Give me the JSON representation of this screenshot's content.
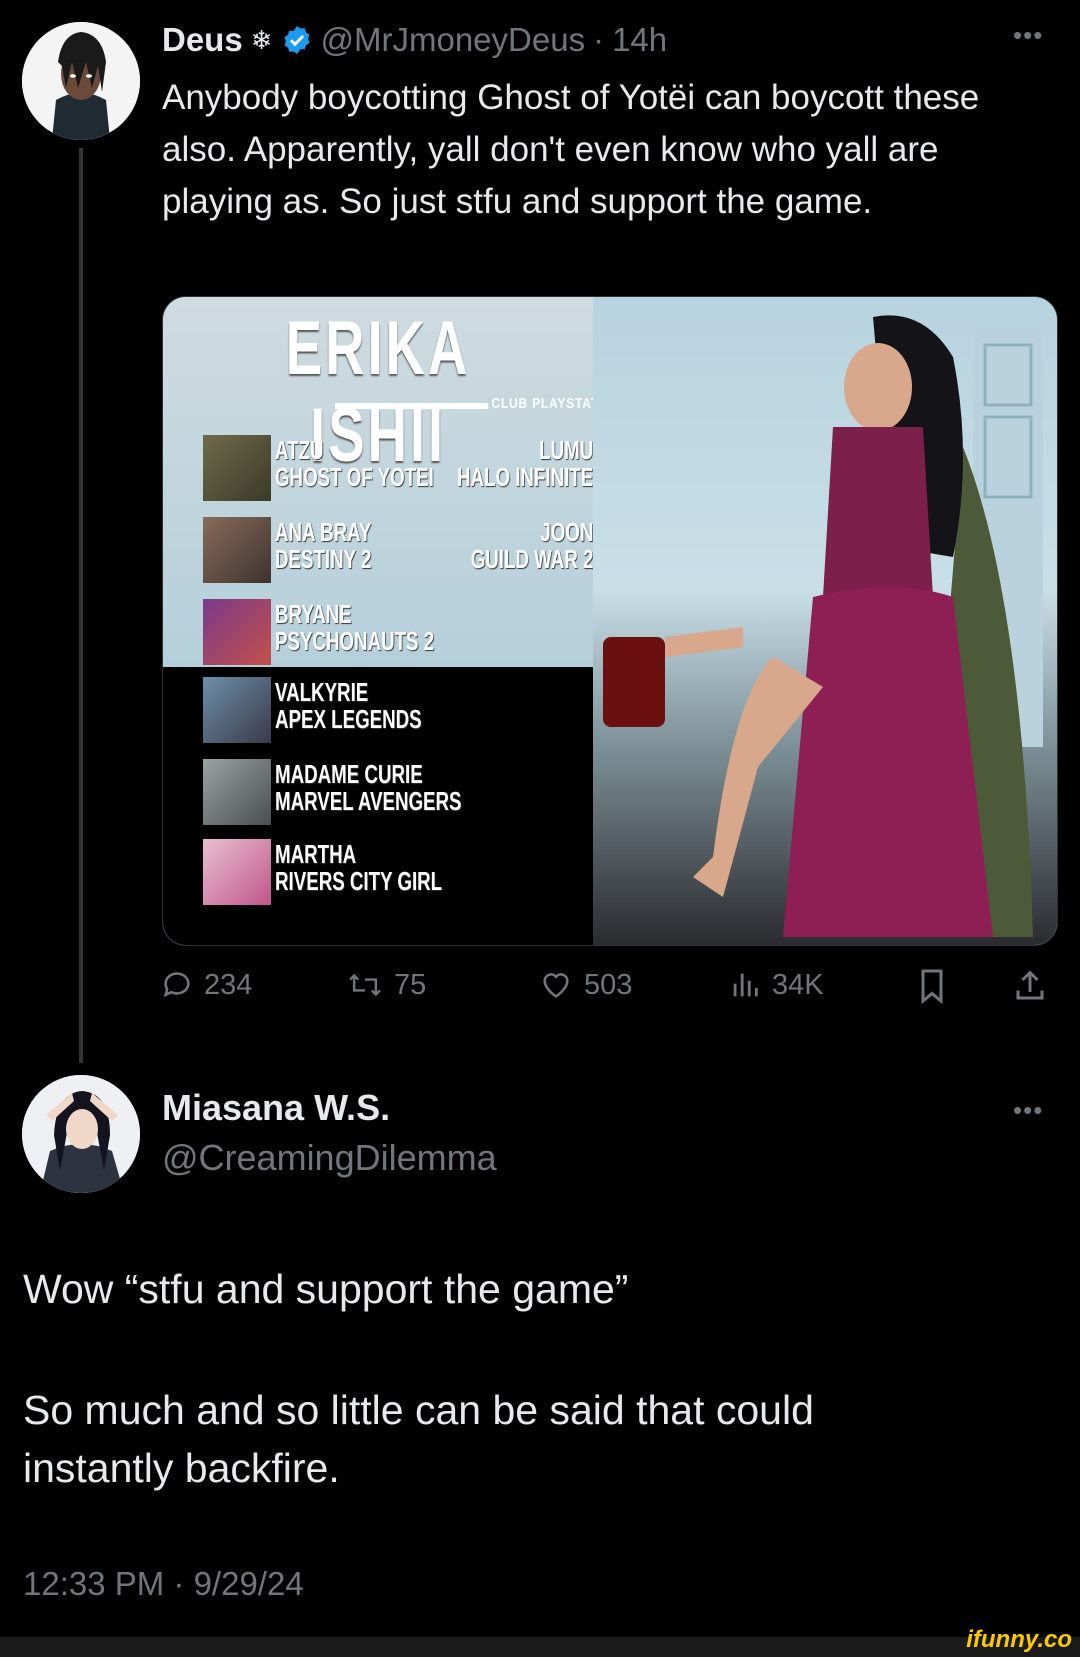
{
  "tweet": {
    "author_name": "Deus",
    "author_glyph": "❄",
    "handle": "@MrJmoneyDeus",
    "separator": "·",
    "time_ago": "14h",
    "text": "Anybody boycotting Ghost of Yotëi can boycott these also. Apparently, yall don't even know who yall are playing as. So just stfu and support the game.",
    "stats": {
      "replies": "234",
      "retweets": "75",
      "likes": "503",
      "views": "34K"
    }
  },
  "poster": {
    "title": "ERIKA ISHII",
    "subtitle": "CLUB PLAYSTATION",
    "roles_left": [
      {
        "character": "ATZU",
        "game": "GHOST OF YOTEI"
      },
      {
        "character": "ANA BRAY",
        "game": "DESTINY 2"
      },
      {
        "character": "BRYANE",
        "game": "PSYCHONAUTS 2"
      },
      {
        "character": "VALKYRIE",
        "game": "APEX LEGENDS"
      },
      {
        "character": "MADAME CURIE",
        "game": "MARVEL AVENGERS"
      },
      {
        "character": "MARTHA",
        "game": "RIVERS CITY GIRL"
      }
    ],
    "roles_right": [
      {
        "character": "LUMU",
        "game": "HALO INFINITE"
      },
      {
        "character": "JOON",
        "game": "GUILD WAR 2"
      }
    ]
  },
  "reply": {
    "author_name": "Miasana W.S.",
    "handle": "@CreamingDilemma",
    "paragraph_1": "Wow “stfu and support the game”",
    "paragraph_2": "So much and so little can be said that could instantly backfire.",
    "timestamp": "12:33 PM · 9/29/24"
  },
  "watermark": "ifunny.co",
  "icons": [
    "verified-badge-icon",
    "more-icon",
    "reply-icon",
    "retweet-icon",
    "like-icon",
    "views-icon",
    "bookmark-icon",
    "share-icon"
  ],
  "colors": {
    "background": "#000000",
    "text": "#e7e9ea",
    "muted": "#71767b",
    "verified": "#1d9bf0",
    "watermark": "#ffc900"
  }
}
